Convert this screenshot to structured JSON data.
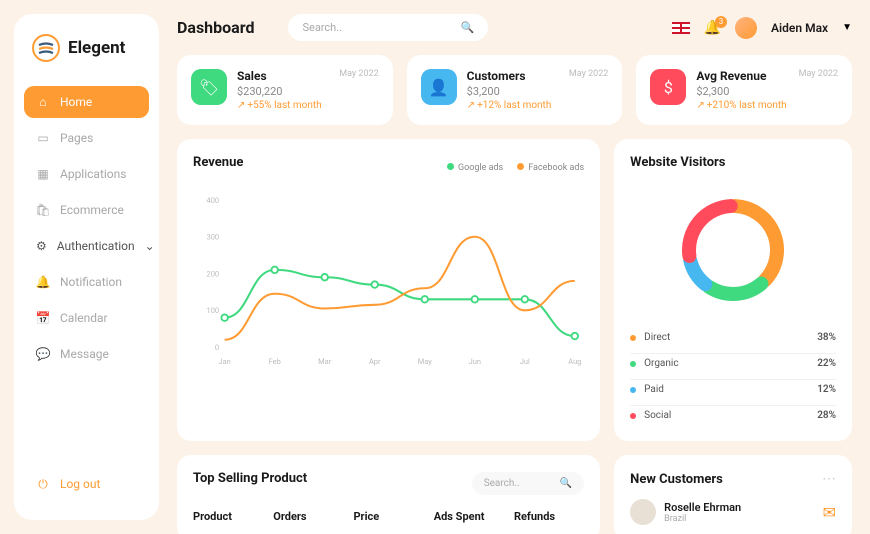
{
  "brand": "Elegent",
  "page_title": "Dashboard",
  "search_placeholder": "Search..",
  "user": {
    "name": "Aiden Max",
    "notification_count": "3"
  },
  "sidebar": {
    "items": [
      {
        "label": "Home",
        "icon": "home-icon",
        "active": true
      },
      {
        "label": "Pages",
        "icon": "pages-icon"
      },
      {
        "label": "Applications",
        "icon": "apps-icon"
      },
      {
        "label": "Ecommerce",
        "icon": "ecommerce-icon"
      },
      {
        "label": "Authentication",
        "icon": "auth-icon",
        "expandable": true
      },
      {
        "label": "Notification",
        "icon": "notif-icon"
      },
      {
        "label": "Calendar",
        "icon": "calendar-icon"
      },
      {
        "label": "Message",
        "icon": "message-icon"
      }
    ],
    "logout": "Log out"
  },
  "stats": [
    {
      "title": "Sales",
      "value": "$230,220",
      "change": "+55% last month",
      "date": "May 2022",
      "color": "#3fd97f",
      "icon": "tag-icon"
    },
    {
      "title": "Customers",
      "value": "$3,200",
      "change": "+12% last month",
      "date": "May 2022",
      "color": "#47b7f0",
      "icon": "user-icon"
    },
    {
      "title": "Avg Revenue",
      "value": "$2,300",
      "change": "+210% last month",
      "date": "May 2022",
      "color": "#ff4b5c",
      "icon": "dollar-icon"
    }
  ],
  "chart_data": {
    "type": "line",
    "title": "Revenue",
    "xlabel": "",
    "ylabel": "",
    "ylim": [
      0,
      400
    ],
    "yticks": [
      0,
      100,
      200,
      300,
      400
    ],
    "categories": [
      "Jan",
      "Feb",
      "Mar",
      "Apr",
      "May",
      "Jun",
      "Jul",
      "Aug"
    ],
    "series": [
      {
        "name": "Google ads",
        "color": "#3fd97f",
        "values": [
          80,
          210,
          190,
          170,
          130,
          130,
          130,
          30
        ]
      },
      {
        "name": "Facebook ads",
        "color": "#ff9b33",
        "values": [
          20,
          145,
          105,
          115,
          160,
          300,
          100,
          180
        ]
      }
    ],
    "legend_position": "top-right"
  },
  "visitors": {
    "title": "Website Visitors",
    "items": [
      {
        "label": "Direct",
        "value": "38%",
        "color": "#ff9b33"
      },
      {
        "label": "Organic",
        "value": "22%",
        "color": "#3fd97f"
      },
      {
        "label": "Paid",
        "value": "12%",
        "color": "#47b7f0"
      },
      {
        "label": "Social",
        "value": "28%",
        "color": "#ff4b5c"
      }
    ]
  },
  "selling": {
    "title": "Top Selling Product",
    "search_placeholder": "Search..",
    "columns": [
      "Product",
      "Orders",
      "Price",
      "Ads Spent",
      "Refunds"
    ]
  },
  "customers": {
    "title": "New Customers",
    "list": [
      {
        "name": "Roselle Ehrman",
        "sub": "Brazil"
      }
    ]
  }
}
